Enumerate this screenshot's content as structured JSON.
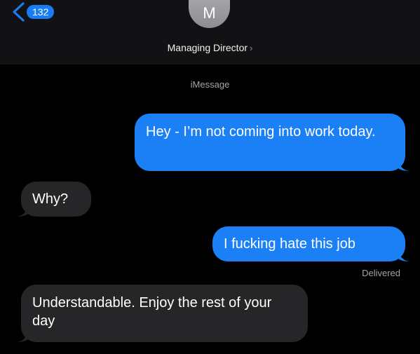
{
  "header": {
    "back_badge": "132",
    "avatar_initial": "M",
    "contact_name": "Managing Director",
    "contact_chevron": "›",
    "icons": {
      "back": "chevron-left-icon",
      "contact_disclosure": "chevron-right-icon"
    }
  },
  "conversation": {
    "service": "iMessage",
    "messages": [
      {
        "direction": "sent",
        "text": "Hey - I’m not coming into work today."
      },
      {
        "direction": "received",
        "text": "Why?"
      },
      {
        "direction": "sent",
        "text": "I fucking hate this job"
      },
      {
        "direction": "received",
        "text": "Understandable. Enjoy the rest of your day"
      }
    ],
    "status": "Delivered"
  },
  "colors": {
    "background": "#000000",
    "header_bg": "#121214",
    "sent_bubble": "#1b80f6",
    "received_bubble": "#262628",
    "accent": "#1a7cf5",
    "secondary_text": "#a5a5aa"
  }
}
